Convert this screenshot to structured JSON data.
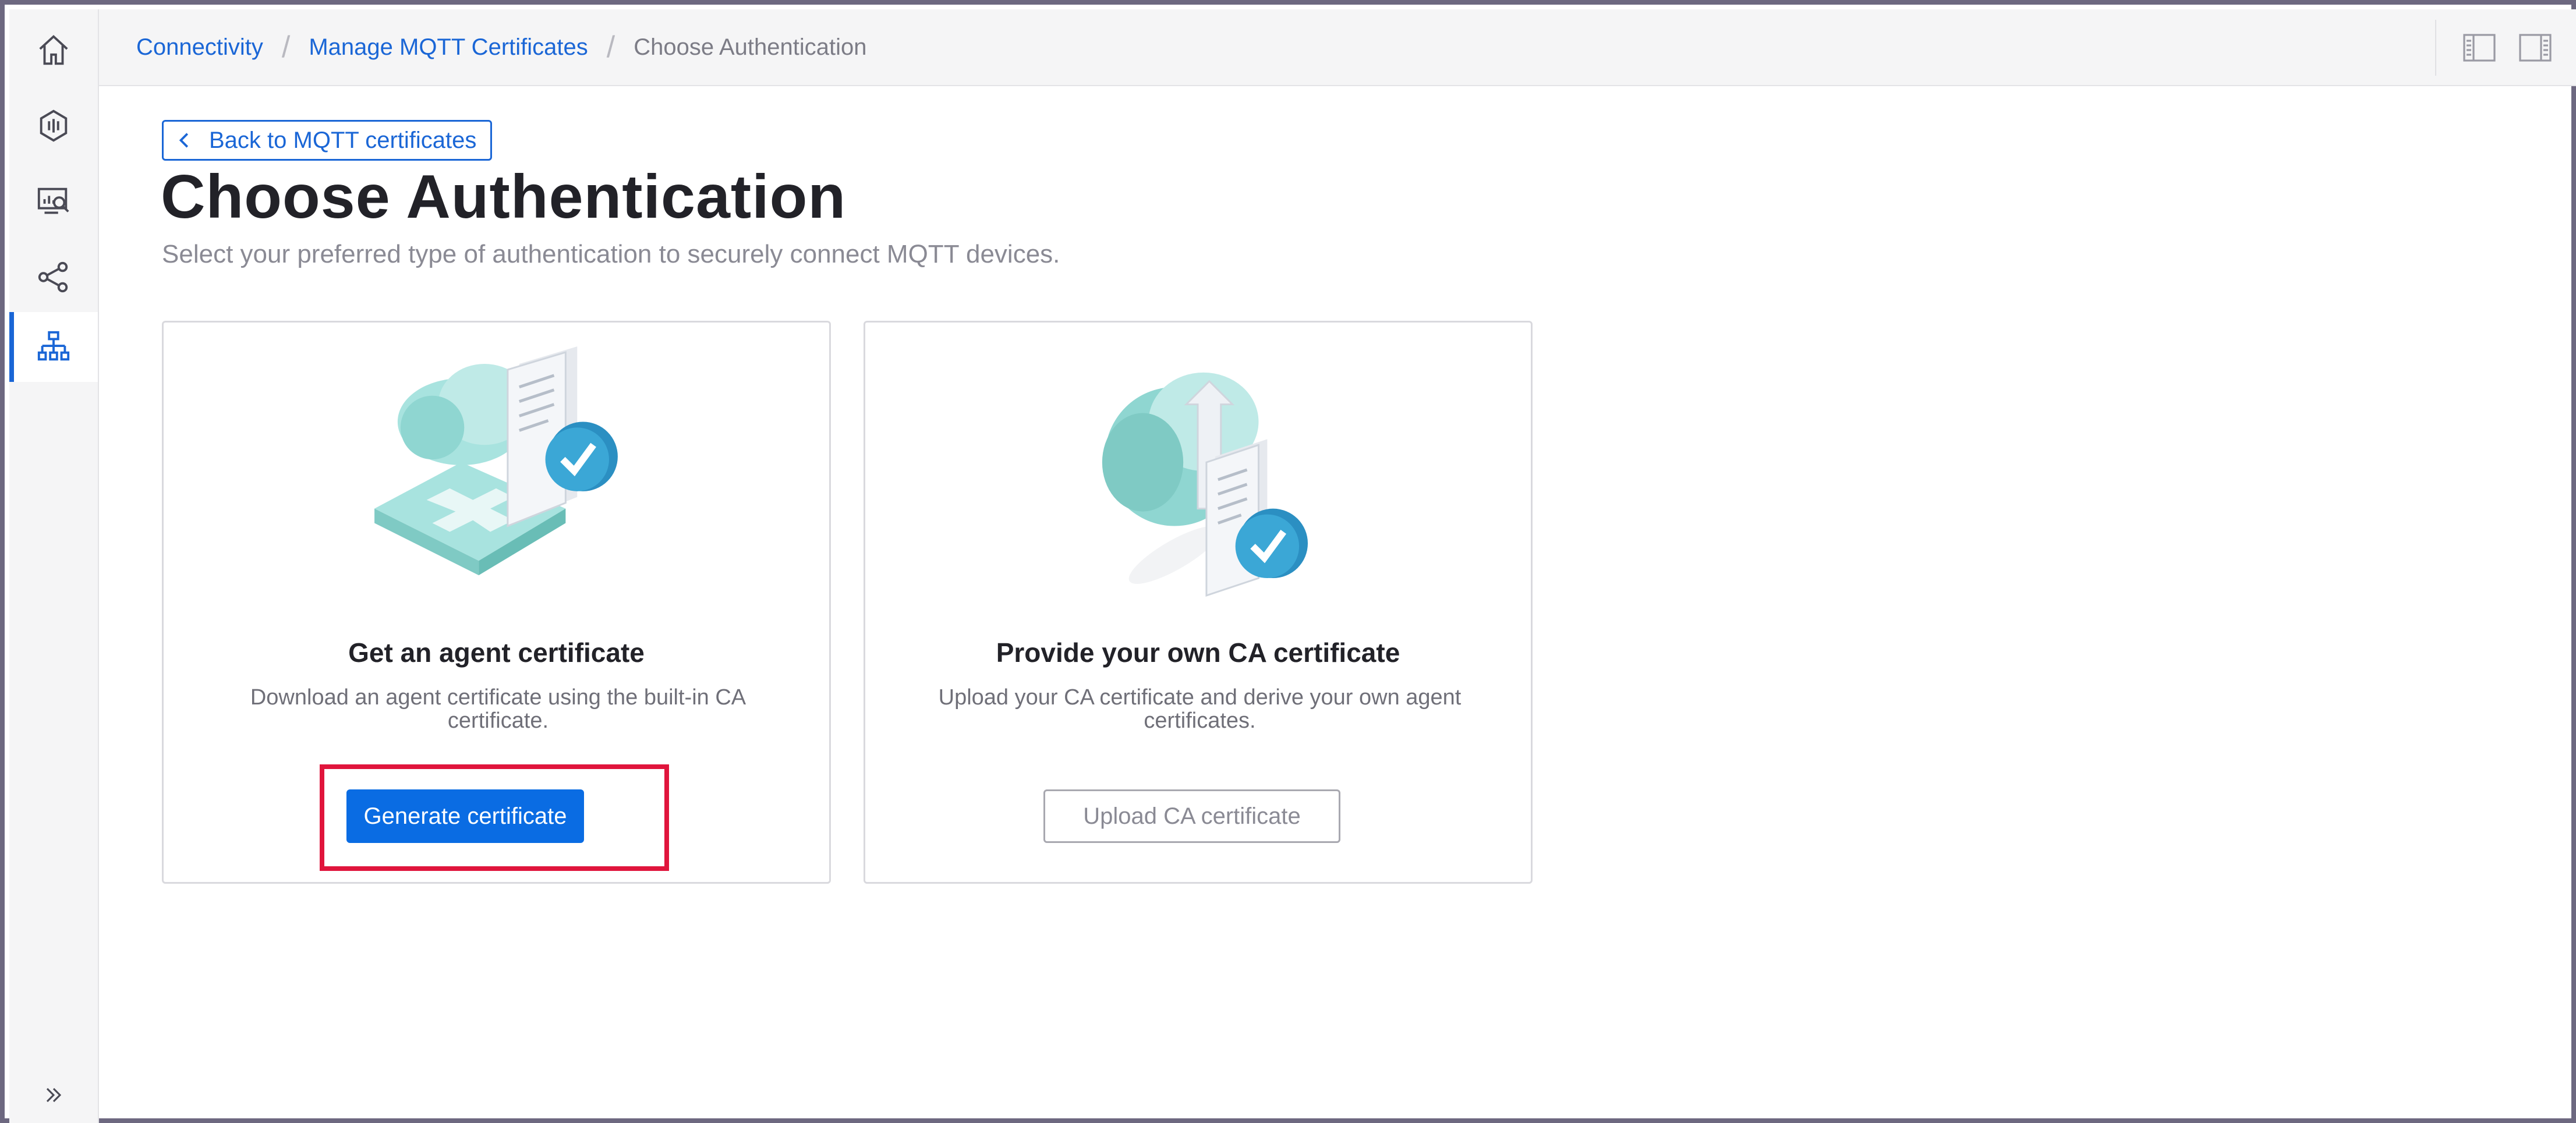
{
  "breadcrumb": {
    "items": [
      "Connectivity",
      "Manage MQTT Certificates"
    ],
    "current": "Choose Authentication",
    "separator": "/"
  },
  "back_link": {
    "label": "Back to MQTT certificates"
  },
  "page": {
    "title": "Choose Authentication",
    "subtitle": "Select your preferred type of authentication to securely connect MQTT devices."
  },
  "cards": [
    {
      "title": "Get an agent certificate",
      "description": "Download an agent certificate using the built-in CA certificate.",
      "button": "Generate certificate"
    },
    {
      "title": "Provide your own CA certificate",
      "description": "Upload your CA certificate and derive your own agent certificates.",
      "button": "Upload CA certificate"
    }
  ],
  "sidebar": {
    "icons": [
      "home-icon",
      "sensor-icon",
      "analytics-icon",
      "share-icon",
      "hierarchy-icon",
      "expand-icon"
    ],
    "active": "hierarchy-icon"
  },
  "colors": {
    "accent": "#1a66d6",
    "primary_button": "#0a6ce3",
    "highlight": "#e0153c",
    "teal": "#7fd3cf"
  }
}
